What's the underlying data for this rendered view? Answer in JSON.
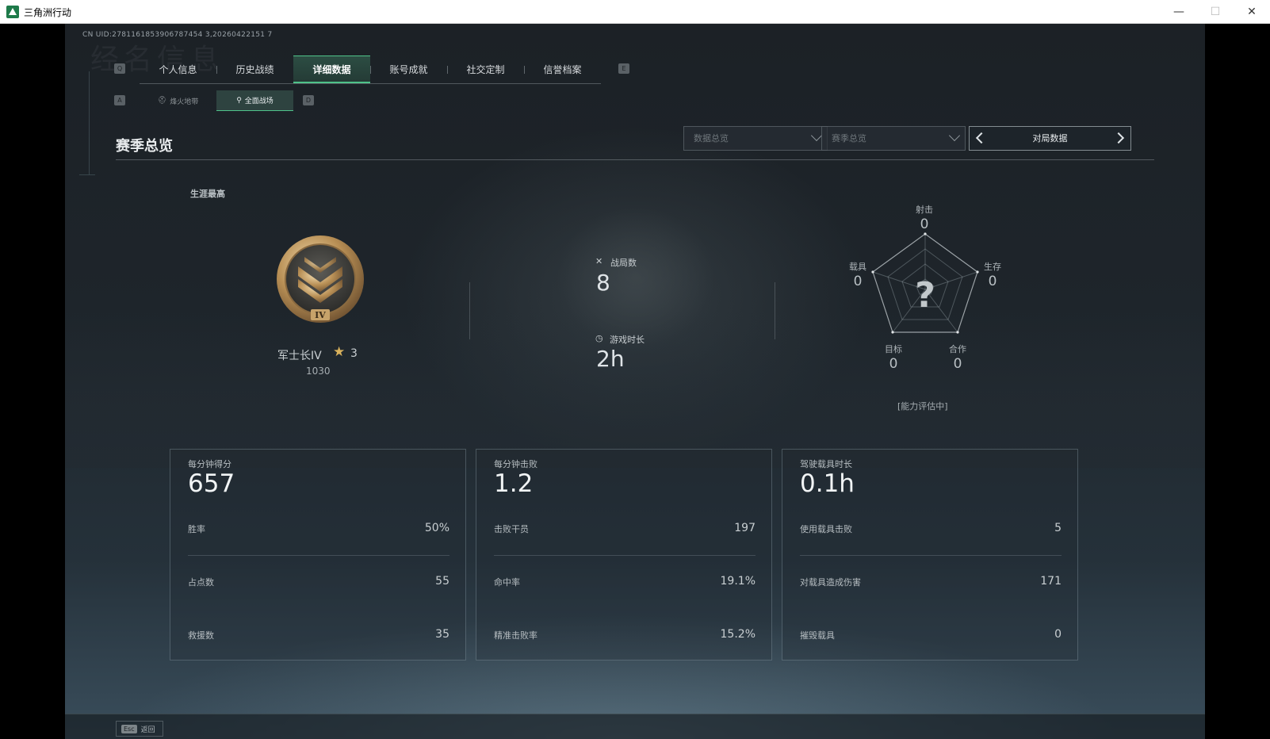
{
  "window": {
    "title": "三角洲行动",
    "minimize": "—",
    "maximize": "☐",
    "close": "✕"
  },
  "uid": "CN UID:2781161853906787454 3,20260422151 7",
  "bg_text": "经名信息",
  "nav": {
    "left_key": "Q",
    "right_key": "E",
    "tabs": [
      {
        "label": "个人信息",
        "active": false
      },
      {
        "label": "历史战绩",
        "active": false
      },
      {
        "label": "详细数据",
        "active": true
      },
      {
        "label": "账号成就",
        "active": false
      },
      {
        "label": "社交定制",
        "active": false
      },
      {
        "label": "信誉档案",
        "active": false
      }
    ]
  },
  "subnav": {
    "left_key": "A",
    "right_key": "D",
    "tabs": [
      {
        "label": "烽火地带",
        "icon": "hat-icon",
        "active": false
      },
      {
        "label": "全面战场",
        "icon": "antenna-icon",
        "active": true
      }
    ]
  },
  "section": {
    "title": "赛季总览"
  },
  "filters": {
    "data_overview": "数据总览",
    "season_overview": "赛季总览",
    "pager_label": "对局数据"
  },
  "career": {
    "label": "生涯最高",
    "rank_name": "军士长IV",
    "stars": "3",
    "score": "1030",
    "rank_numeral": "IV"
  },
  "summary": {
    "matches_label": "战局数",
    "matches_value": "8",
    "playtime_label": "游戏时长",
    "playtime_value": "2h"
  },
  "radar": {
    "shooting_label": "射击",
    "shooting_value": "0",
    "vehicle_label": "载具",
    "vehicle_value": "0",
    "survival_label": "生存",
    "survival_value": "0",
    "objective_label": "目标",
    "objective_value": "0",
    "teamwork_label": "合作",
    "teamwork_value": "0",
    "center_mark": "?",
    "status": "[能力评估中]"
  },
  "cards": [
    {
      "title": "每分钟得分",
      "big": "657",
      "rows": [
        {
          "label": "胜率",
          "value": "50%"
        },
        {
          "label": "占点数",
          "value": "55"
        },
        {
          "label": "救援数",
          "value": "35"
        }
      ]
    },
    {
      "title": "每分钟击败",
      "big": "1.2",
      "rows": [
        {
          "label": "击败干员",
          "value": "197"
        },
        {
          "label": "命中率",
          "value": "19.1%"
        },
        {
          "label": "精准击败率",
          "value": "15.2%"
        }
      ]
    },
    {
      "title": "驾驶载具时长",
      "big": "0.1h",
      "rows": [
        {
          "label": "使用载具击败",
          "value": "5"
        },
        {
          "label": "对载具造成伤害",
          "value": "171"
        },
        {
          "label": "摧毁载具",
          "value": "0"
        }
      ]
    }
  ],
  "footer": {
    "esc_key": "Esc",
    "back_label": "返回"
  }
}
